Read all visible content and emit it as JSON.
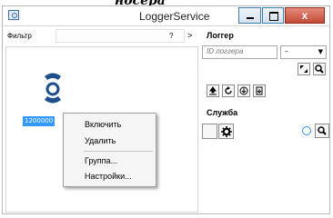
{
  "caption": "носера",
  "window": {
    "title": "LoggerService",
    "close_glyph": "x"
  },
  "toolbar": {
    "filter_label": "Фильтр",
    "filter_value": "",
    "help_label": "?",
    "nav_arrow": ">"
  },
  "tree": {
    "item_label": "1200000",
    "icon": "service-icon"
  },
  "context_menu": {
    "items": [
      "Включить",
      "Удалить",
      "Группа...",
      "Настройки..."
    ]
  },
  "logger": {
    "title": "Логгер",
    "id_placeholder": "ID логгера",
    "select_value": "–",
    "buttons": [
      "upload-icon",
      "refresh-icon",
      "download-icon",
      "export-icon"
    ]
  },
  "service": {
    "title": "Служба"
  },
  "colors": {
    "selection": "#3399ff",
    "close_button": "#c44a37",
    "accent": "#1f4e8c"
  }
}
